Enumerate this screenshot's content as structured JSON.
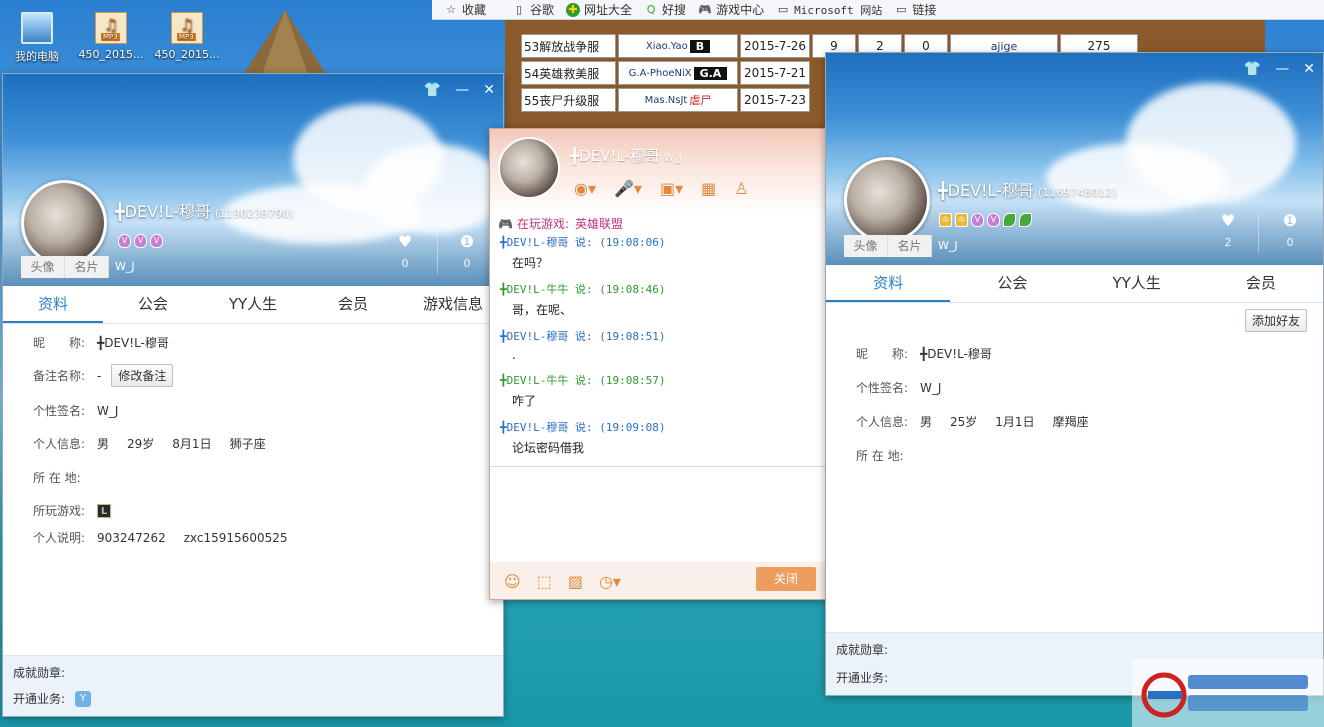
{
  "desktop": {
    "icons": [
      {
        "label": "我的电脑"
      },
      {
        "label": "450_2015..."
      },
      {
        "label": "450_2015..."
      }
    ]
  },
  "bookmarks": [
    "收藏",
    "谷歌",
    "网址大全",
    "好搜",
    "游戏中心",
    "Microsoft 网站",
    "链接"
  ],
  "bgtable": {
    "rows": [
      {
        "name": "53解放战争服",
        "admin": "Xiao.Yao",
        "tag": "B",
        "date": "2015-7-26",
        "a": "9",
        "b": "2",
        "c": "0",
        "user": "ajige",
        "num": "275"
      },
      {
        "name": "54英雄救美服",
        "admin": "G.A-PhoeNiX",
        "tag": "G.A",
        "date": "2015-7-21",
        "a": "",
        "b": "",
        "c": "",
        "user": "",
        "num": ""
      },
      {
        "name": "55丧尸升级服",
        "admin": "Mas.NsJt",
        "tag": "虐尸",
        "date": "2015-7-23",
        "a": "",
        "b": "",
        "c": "",
        "user": "",
        "num": ""
      }
    ]
  },
  "left_profile": {
    "name": "╋DEV!L-穆哥",
    "id": "(1190239790)",
    "signature": "W_J",
    "photo_tabs": [
      "头像",
      "名片"
    ],
    "likes": "0",
    "honors": "0",
    "tabs": [
      "资料",
      "公会",
      "YY人生",
      "会员",
      "游戏信息"
    ],
    "fields": {
      "nick_label": "昵　　称:",
      "nick": "╋DEV!L-穆哥",
      "remark_label": "备注名称:",
      "remark": "-",
      "remark_btn": "修改备注",
      "sig_label": "个性签名:",
      "sig": "W_J",
      "info_label": "个人信息:",
      "gender": "男",
      "age": "29岁",
      "birthday": "8月1日",
      "zodiac": "狮子座",
      "loc_label": "所 在 地:",
      "game_label": "所玩游戏:",
      "desc_label": "个人说明:",
      "desc1": "903247262",
      "desc2": "zxc15915600525"
    },
    "footer": {
      "medal_label": "成就勋章:",
      "service_label": "开通业务:"
    }
  },
  "chat": {
    "name": "╋DEV!L-穆哥",
    "sig": "W_J",
    "playing_label": "在玩游戏:",
    "playing_game": "英雄联盟",
    "messages": [
      {
        "who": "╋DEV!L-穆哥 说: (19:08:06)",
        "text": "在吗？",
        "me": true
      },
      {
        "who": "╋DEV!L-牛牛 说: (19:08:46)",
        "text": "哥，在呢、",
        "me": false
      },
      {
        "who": "╋DEV!L-穆哥 说: (19:08:51)",
        "text": ".",
        "me": true
      },
      {
        "who": "╋DEV!L-牛牛 说: (19:08:57)",
        "text": "咋了",
        "me": false
      },
      {
        "who": "╋DEV!L-穆哥 说: (19:09:08)",
        "text": "论坛密码借我",
        "me": true
      }
    ],
    "close_label": "关闭"
  },
  "right_profile": {
    "name": "╋DEV!L-穆哥",
    "id": "(1169748012)",
    "signature": "W_J",
    "photo_tabs": [
      "头像",
      "名片"
    ],
    "likes": "2",
    "honors": "0",
    "tabs": [
      "资料",
      "公会",
      "YY人生",
      "会员"
    ],
    "add_friend": "添加好友",
    "fields": {
      "nick_label": "昵　　称:",
      "nick": "╋DEV!L-穆哥",
      "sig_label": "个性签名:",
      "sig": "W_J",
      "info_label": "个人信息:",
      "gender": "男",
      "age": "25岁",
      "birthday": "1月1日",
      "zodiac": "摩羯座",
      "loc_label": "所 在 地:"
    },
    "footer": {
      "medal_label": "成就勋章:",
      "service_label": "开通业务:"
    }
  }
}
